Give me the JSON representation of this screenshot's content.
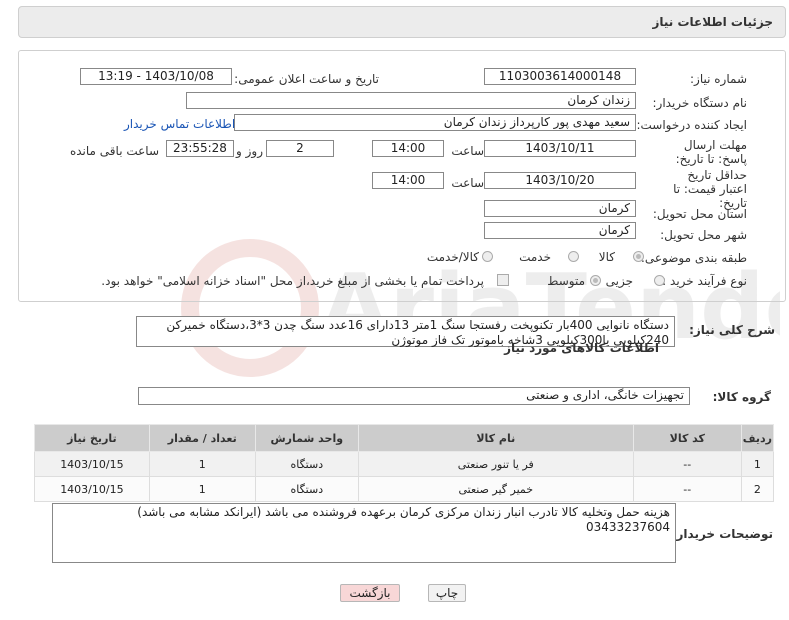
{
  "page": {
    "title": "جزئیات اطلاعات نیاز"
  },
  "form": {
    "need_number_label": "شماره نیاز:",
    "need_number": "1103003614000148",
    "announce_label": "تاریخ و ساعت اعلان عمومی:",
    "announce_value": "1403/10/08 - 13:19",
    "buyer_org_label": "نام دستگاه خریدار:",
    "buyer_org": "زندان کرمان",
    "creator_label": "ایجاد کننده درخواست:",
    "creator": "سعید مهدی پور کارپرداز زندان کرمان",
    "contact_link": "اطلاعات تماس خریدار",
    "deadline_label": "مهلت ارسال پاسخ: تا تاریخ:",
    "deadline_date": "1403/10/11",
    "time_label": "ساعت",
    "deadline_time": "14:00",
    "days": "2",
    "days_label": "روز و",
    "remaining": "23:55:28",
    "remaining_label": "ساعت باقی مانده",
    "validity_label": "حداقل تاریخ اعتبار قیمت: تا تاریخ:",
    "validity_date": "1403/10/20",
    "validity_time_label": "ساعت",
    "validity_time": "14:00",
    "province_label": "استان محل تحویل:",
    "province": "کرمان",
    "city_label": "شهر محل تحویل:",
    "city": "کرمان",
    "category_label": "طبقه بندی موضوعی:",
    "category_options": [
      "کالا",
      "خدمت",
      "کالا/خدمت"
    ],
    "process_label": "نوع فرآیند خرید :",
    "process_options": [
      "جزیی",
      "متوسط"
    ],
    "payment_note": "پرداخت تمام یا بخشی از مبلغ خرید،از محل \"اسناد خزانه اسلامی\" خواهد بود."
  },
  "description": {
    "label": "شرح کلی نیاز:",
    "text_line1": "دستگاه نانوایی 400بار تکنوپخت رفستجا سنگ 1متر 13دارای 16عدد سنگ چدن 3*3،دستگاه خمیرکن",
    "text_line2": "240کیلویی یا300کیلویی 3شاخه باموتور تک فاز موتوژن"
  },
  "goods": {
    "section_title": "اطلاعات کالاهای مورد نیاز",
    "group_label": "گروه کالا:",
    "group_value": "تجهیزات خانگی، اداری و صنعتی",
    "columns": [
      "ردیف",
      "کد کالا",
      "نام کالا",
      "واحد شمارش",
      "تعداد / مقدار",
      "تاریخ نیاز"
    ],
    "rows": [
      {
        "index": "1",
        "code": "--",
        "name": "فر یا تنور صنعتی",
        "unit": "دستگاه",
        "qty": "1",
        "date": "1403/10/15"
      },
      {
        "index": "2",
        "code": "--",
        "name": "خمیر گیر صنعتی",
        "unit": "دستگاه",
        "qty": "1",
        "date": "1403/10/15"
      }
    ]
  },
  "buyer_notes": {
    "label": "توضیحات خریدار:",
    "line1": "هزینه حمل وتخلیه کالا تادرب انبار زندان مرکزی کرمان برعهده فروشنده می باشد (ایرانکد مشابه می باشد)",
    "line2": "03433237604"
  },
  "buttons": {
    "print": "چاپ",
    "back": "بازگشت"
  },
  "colors": {
    "header_bg": "#ececec",
    "table_header_bg": "#cccccc",
    "back_button_bg": "#f8d7d7",
    "link": "#1a55b5"
  }
}
